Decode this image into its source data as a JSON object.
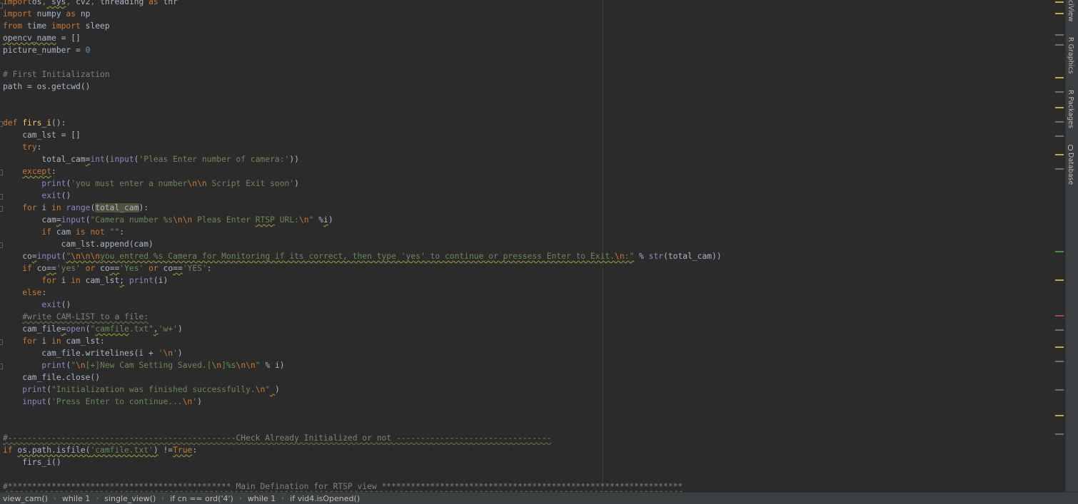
{
  "editor": {
    "lines": [
      {
        "tokens": [
          [
            "kw",
            "import"
          ],
          [
            "",
            "os"
          ],
          [
            "kw",
            ","
          ],
          [
            "wv",
            " sys"
          ],
          [
            "kw",
            ","
          ],
          [
            "",
            " cv2"
          ],
          [
            "kw",
            ","
          ],
          [
            "",
            " threading "
          ],
          [
            "kw",
            "as"
          ],
          [
            "",
            " thr"
          ]
        ]
      },
      {
        "tokens": [
          [
            "kw",
            "import"
          ],
          [
            "",
            " numpy "
          ],
          [
            "kw",
            "as"
          ],
          [
            "",
            " np"
          ]
        ]
      },
      {
        "tokens": [
          [
            "kw",
            "from"
          ],
          [
            "",
            " time "
          ],
          [
            "kw",
            "import"
          ],
          [
            "",
            " sleep"
          ]
        ]
      },
      {
        "tokens": [
          [
            "wv",
            "opencv_name"
          ],
          [
            "",
            " = []"
          ]
        ]
      },
      {
        "tokens": [
          [
            "",
            "picture_number = "
          ],
          [
            "nu",
            "0"
          ]
        ]
      },
      {
        "tokens": []
      },
      {
        "tokens": [
          [
            "cm",
            "# First Initialization"
          ]
        ]
      },
      {
        "tokens": [
          [
            "",
            "path = os.getcwd()"
          ]
        ]
      },
      {
        "tokens": []
      },
      {
        "tokens": []
      },
      {
        "tokens": [
          [
            "kw",
            "def "
          ],
          [
            "fn",
            "firs_i"
          ],
          [
            "",
            "():"
          ]
        ]
      },
      {
        "tokens": [
          [
            "",
            "    cam_lst = []"
          ]
        ]
      },
      {
        "tokens": [
          [
            "",
            "    "
          ],
          [
            "kw",
            "try"
          ],
          [
            "",
            ":"
          ]
        ]
      },
      {
        "tokens": [
          [
            "",
            "        total_cam"
          ],
          [
            "wv",
            "="
          ],
          [
            "bi",
            "int"
          ],
          [
            "",
            "("
          ],
          [
            "bi",
            "input"
          ],
          [
            "",
            "("
          ],
          [
            "st",
            "'Pleas Enter number of camera:'"
          ],
          [
            "",
            "))"
          ]
        ]
      },
      {
        "tokens": [
          [
            "",
            "    "
          ],
          [
            "kw wv",
            "except"
          ],
          [
            "",
            ":"
          ]
        ]
      },
      {
        "tokens": [
          [
            "",
            "        "
          ],
          [
            "bi",
            "print"
          ],
          [
            "",
            "("
          ],
          [
            "st",
            "'you must enter a number"
          ],
          [
            "es",
            "\\n\\n"
          ],
          [
            "st",
            " Script Exit soon'"
          ],
          [
            "",
            ")"
          ]
        ]
      },
      {
        "tokens": [
          [
            "",
            "        "
          ],
          [
            "bi",
            "exit"
          ],
          [
            "",
            "()"
          ]
        ]
      },
      {
        "tokens": [
          [
            "",
            "    "
          ],
          [
            "kw",
            "for"
          ],
          [
            "",
            " i "
          ],
          [
            "kw",
            "in"
          ],
          [
            "",
            " "
          ],
          [
            "bi",
            "range"
          ],
          [
            "",
            "("
          ],
          [
            "hl",
            "total_cam"
          ],
          [
            "",
            "):"
          ]
        ]
      },
      {
        "tokens": [
          [
            "",
            "        cam"
          ],
          [
            "wv",
            "="
          ],
          [
            "bi",
            "input"
          ],
          [
            "",
            "("
          ],
          [
            "st",
            "\"Camera number %s"
          ],
          [
            "es",
            "\\n\\n"
          ],
          [
            "st",
            " Pleas Enter "
          ],
          [
            "st wv",
            "RTSP"
          ],
          [
            "st",
            " URL:"
          ],
          [
            "es",
            "\\n"
          ],
          [
            "st",
            "\""
          ],
          [
            "",
            " %"
          ],
          [
            "wv",
            "i"
          ],
          [
            "",
            ")"
          ]
        ]
      },
      {
        "tokens": [
          [
            "",
            "        "
          ],
          [
            "kw",
            "if"
          ],
          [
            "",
            " cam "
          ],
          [
            "kw",
            "is not"
          ],
          [
            "",
            " "
          ],
          [
            "st",
            "\"\""
          ],
          [
            "",
            ":"
          ]
        ]
      },
      {
        "tokens": [
          [
            "",
            "            cam_lst.append(cam)"
          ]
        ]
      },
      {
        "tokens": [
          [
            "",
            "    co"
          ],
          [
            "wv",
            "="
          ],
          [
            "bi",
            "input"
          ],
          [
            "",
            "("
          ],
          [
            "st wv",
            "\""
          ],
          [
            "es wv",
            "\\n\\n\\n"
          ],
          [
            "st wv",
            "you entred %s Camera for Monitoring if its correct, then type 'yes' to continue or pressess Enter to Exit."
          ],
          [
            "es wv",
            "\\n"
          ],
          [
            "st wv",
            ":\""
          ],
          [
            "",
            " % "
          ],
          [
            "bi",
            "str"
          ],
          [
            "",
            "(total_cam))"
          ]
        ]
      },
      {
        "tokens": [
          [
            "",
            "    "
          ],
          [
            "kw",
            "if"
          ],
          [
            "",
            " co"
          ],
          [
            "wv",
            "=="
          ],
          [
            "st",
            "'yes'"
          ],
          [
            "",
            " "
          ],
          [
            "kw",
            "or"
          ],
          [
            "",
            " co"
          ],
          [
            "wv",
            "=="
          ],
          [
            "st",
            "'Yes'"
          ],
          [
            "",
            " "
          ],
          [
            "kw",
            "or"
          ],
          [
            "",
            " co"
          ],
          [
            "wv",
            "=="
          ],
          [
            "st",
            "'YES'"
          ],
          [
            "",
            ":"
          ]
        ]
      },
      {
        "tokens": [
          [
            "",
            "        "
          ],
          [
            "kw",
            "for"
          ],
          [
            "",
            " i "
          ],
          [
            "kw",
            "in"
          ],
          [
            "",
            " cam_lst"
          ],
          [
            "wv",
            ";"
          ],
          [
            "",
            " "
          ],
          [
            "bi",
            "print"
          ],
          [
            "",
            "(i)"
          ]
        ]
      },
      {
        "tokens": [
          [
            "",
            "    "
          ],
          [
            "kw",
            "else"
          ],
          [
            "",
            ":"
          ]
        ]
      },
      {
        "tokens": [
          [
            "",
            "        "
          ],
          [
            "bi",
            "exit"
          ],
          [
            "",
            "()"
          ]
        ]
      },
      {
        "tokens": [
          [
            "",
            "    "
          ],
          [
            "cm wv-cm",
            "#write CAM-LIST to a file:"
          ]
        ]
      },
      {
        "tokens": [
          [
            "",
            "    cam_file"
          ],
          [
            "wv",
            "="
          ],
          [
            "bi",
            "open"
          ],
          [
            "",
            "("
          ],
          [
            "st",
            "\""
          ],
          [
            "st wv",
            "camfile"
          ],
          [
            "st",
            ".txt\""
          ],
          [
            "wv",
            ","
          ],
          [
            "st",
            "'w+'"
          ],
          [
            "",
            ")"
          ]
        ]
      },
      {
        "tokens": [
          [
            "",
            "    "
          ],
          [
            "kw",
            "for"
          ],
          [
            "",
            " i "
          ],
          [
            "kw",
            "in"
          ],
          [
            "",
            " cam_lst:"
          ]
        ]
      },
      {
        "tokens": [
          [
            "",
            "        cam_file.writelines(i + "
          ],
          [
            "st",
            "'"
          ],
          [
            "es",
            "\\n"
          ],
          [
            "st",
            "'"
          ],
          [
            "",
            ")"
          ]
        ]
      },
      {
        "tokens": [
          [
            "",
            "        "
          ],
          [
            "bi",
            "print"
          ],
          [
            "",
            "("
          ],
          [
            "st",
            "\""
          ],
          [
            "es",
            "\\n"
          ],
          [
            "st",
            "[+]New Cam Setting Saved.["
          ],
          [
            "es",
            "\\n"
          ],
          [
            "st",
            "]%s"
          ],
          [
            "es",
            "\\n\\n"
          ],
          [
            "st",
            "\""
          ],
          [
            "",
            " % i)"
          ]
        ]
      },
      {
        "tokens": [
          [
            "",
            "    cam_file.close()"
          ]
        ]
      },
      {
        "tokens": [
          [
            "",
            "    "
          ],
          [
            "bi",
            "print"
          ],
          [
            "",
            "("
          ],
          [
            "st",
            "\"Initialization was finished successfully."
          ],
          [
            "es",
            "\\n"
          ],
          [
            "st",
            "\""
          ],
          [
            "wv",
            " "
          ],
          [
            "",
            ")"
          ]
        ]
      },
      {
        "tokens": [
          [
            "",
            "    "
          ],
          [
            "bi",
            "input"
          ],
          [
            "",
            "("
          ],
          [
            "st",
            "'Press Enter to continue..."
          ],
          [
            "es",
            "\\n"
          ],
          [
            "st",
            "'"
          ],
          [
            "",
            ")"
          ]
        ]
      },
      {
        "tokens": []
      },
      {
        "tokens": []
      },
      {
        "tokens": [
          [
            "cm wv-cm",
            "#-----------------------------------------------CHeck Already Initialized or not --------------------------------"
          ]
        ]
      },
      {
        "tokens": [
          [
            "kw",
            "if"
          ],
          [
            "",
            " "
          ],
          [
            "wv",
            "os.path.isfile("
          ],
          [
            "st wv",
            "'camfile.txt'"
          ],
          [
            "wv",
            ")"
          ],
          [
            "",
            " !="
          ],
          [
            "kw wv",
            "True"
          ],
          [
            "",
            ":"
          ]
        ]
      },
      {
        "tokens": [
          [
            "",
            "    firs_i()"
          ]
        ]
      },
      {
        "tokens": []
      },
      {
        "tokens": [
          [
            "cm wv-cm",
            "#********************************************** Main Defination for RTSP view **************************************************************"
          ]
        ]
      }
    ]
  },
  "tool_tabs": [
    "ciView",
    "R Graphics",
    "R Packages",
    "Database"
  ],
  "breadcrumbs": [
    "view_cam()",
    "while 1",
    "single_view()",
    "if cn == ord('4')",
    "while 1",
    "if vid4.isOpened()"
  ],
  "scroll_markers": [
    {
      "c": "#bba94a"
    },
    {
      "c": "#bba94a"
    },
    {
      "c": "#6e6e6e"
    },
    {
      "c": "#6e6e6e"
    },
    {
      "c": "#bba94a"
    },
    {
      "c": "#6e6e6e"
    },
    {
      "c": "#bba94a"
    },
    {
      "c": "#6e6e6e"
    },
    {
      "c": "#6e6e6e"
    },
    {
      "c": "#bba94a"
    },
    {
      "c": "#6e6e6e"
    },
    {
      "c": "#4a8a4a"
    },
    {
      "c": "#bba94a"
    },
    {
      "c": "#a04848"
    },
    {
      "c": "#6e6e6e"
    },
    {
      "c": "#bba94a"
    },
    {
      "c": "#6e6e6e"
    },
    {
      "c": "#6e6e6e"
    },
    {
      "c": "#bba94a"
    },
    {
      "c": "#6e6e6e"
    }
  ]
}
